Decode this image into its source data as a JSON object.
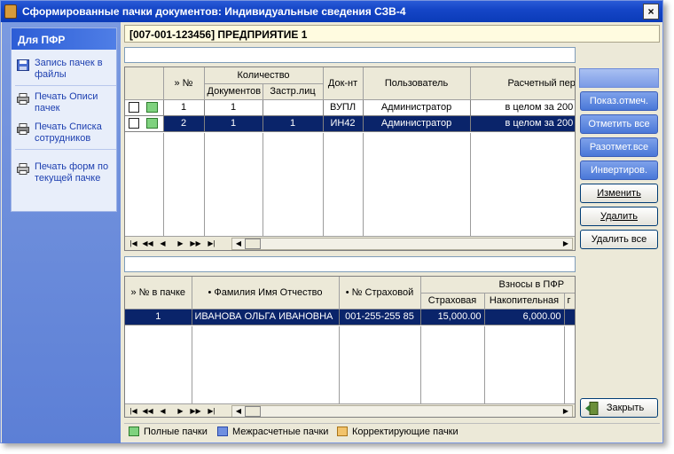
{
  "window": {
    "title": "Сформированные пачки документов: Индивидуальные сведения СЗВ-4"
  },
  "task_panel": {
    "header": "Для ПФР",
    "items": [
      {
        "label1": "Запись пачек в",
        "label2": "файлы",
        "icon": "floppy-disk-icon"
      },
      {
        "label1": "Печать Описи",
        "label2": "пачек",
        "icon": "printer-icon"
      },
      {
        "label1": "Печать Списка",
        "label2": "сотрудников",
        "icon": "printer-icon"
      },
      {
        "label1": "Печать форм по",
        "label2": "текущей пачке",
        "icon": "printer-icon"
      }
    ]
  },
  "header": {
    "text": "[007-001-123456] ПРЕДПРИЯТИЕ 1"
  },
  "top_grid": {
    "col_num": "» №",
    "col_qty": "Количество",
    "col_docs": "Документов",
    "col_ins": "Застр.лиц",
    "col_doc": "Док-нт",
    "col_user": "Пользователь",
    "col_period": "Расчетный пер",
    "rows": [
      {
        "n": "1",
        "docs": "1",
        "ins": "",
        "doc": "ВУПЛ",
        "user": "Администратор",
        "period": "в целом за 200"
      },
      {
        "n": "2",
        "docs": "1",
        "ins": "1",
        "doc": "ИН42",
        "user": "Администратор",
        "period": "в целом за 200"
      }
    ]
  },
  "bottom_grid": {
    "col_pack": "» № в пачке",
    "col_name": "• Фамилия Имя Отчество",
    "col_ins": "• № Страховой",
    "col_contrib": "Взносы в ПФР",
    "col_ins_part": "Страховая",
    "col_acc_part": "Накопительная",
    "col_more": "г",
    "rows": [
      {
        "pack": "1",
        "name": "ИВАНОВА ОЛЬГА ИВАНОВНА",
        "ins": "001-255-255 85",
        "ins_part": "15,000.00",
        "acc_part": "6,000.00"
      }
    ]
  },
  "buttons": {
    "show_marked": "Показ.отмеч.",
    "mark_all": "Отметить все",
    "unmark_all": "Разотмет.все",
    "invert": "Инвертиров.",
    "edit": "Изменить",
    "delete": "Удалить",
    "delete_all": "Удалить все",
    "close": "Закрыть"
  },
  "legend": {
    "full": "Полные пачки",
    "inter": "Межрасчетные пачки",
    "corr": "Корректирующие пачки"
  },
  "colors": {
    "selection": "#0a246a",
    "full": "#7fd27f",
    "inter": "#6f8fe0",
    "corr": "#f2c36b"
  }
}
